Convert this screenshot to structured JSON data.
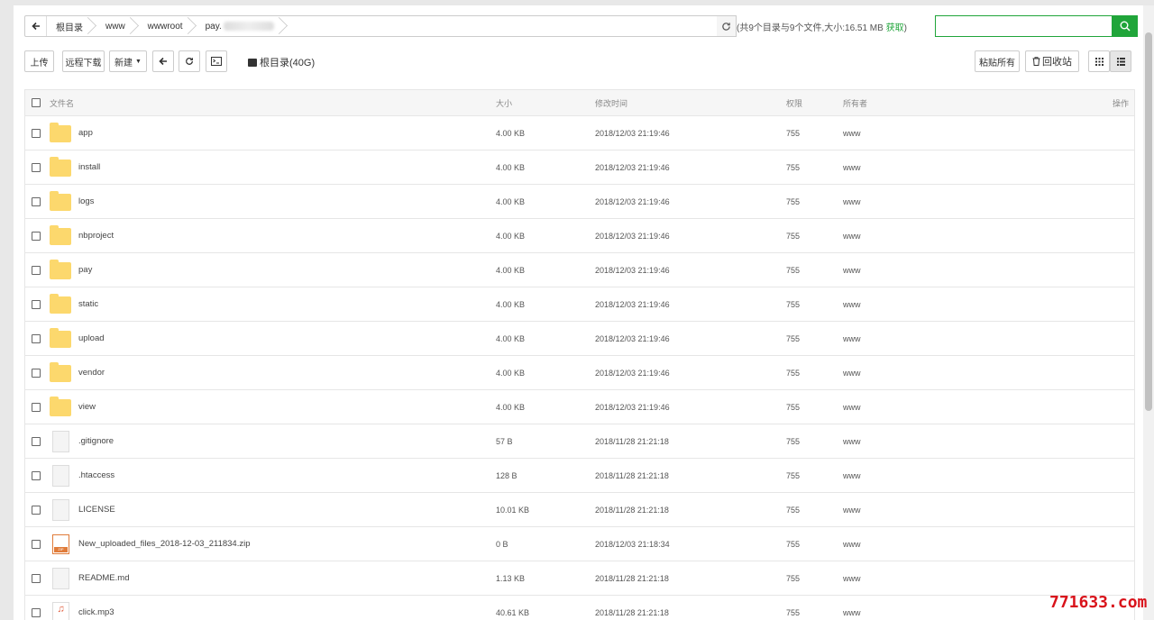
{
  "pathbar": {
    "back_icon": "arrow-left-icon",
    "crumbs": [
      "根目录",
      "www",
      "wwwroot",
      "pay."
    ],
    "summary": "(共9个目录与9个文件,大小:16.51 MB",
    "fetch_label": "获取",
    "summary_close": ")",
    "search_value": "",
    "search_icon": "search-icon",
    "accent": "#20a53a"
  },
  "toolbar": {
    "upload": "上传",
    "remote_download": "远程下载",
    "new": "新建",
    "disk_label": "根目录(40G)",
    "paste_all": "粘贴所有",
    "recycle_bin": "回收站"
  },
  "table": {
    "headers": {
      "name": "文件名",
      "size": "大小",
      "mtime": "修改时间",
      "perm": "权限",
      "owner": "所有者",
      "ops": "操作"
    },
    "rows": [
      {
        "type": "folder",
        "name": "app",
        "size": "4.00 KB",
        "mtime": "2018/12/03 21:19:46",
        "perm": "755",
        "owner": "www"
      },
      {
        "type": "folder",
        "name": "install",
        "size": "4.00 KB",
        "mtime": "2018/12/03 21:19:46",
        "perm": "755",
        "owner": "www"
      },
      {
        "type": "folder",
        "name": "logs",
        "size": "4.00 KB",
        "mtime": "2018/12/03 21:19:46",
        "perm": "755",
        "owner": "www"
      },
      {
        "type": "folder",
        "name": "nbproject",
        "size": "4.00 KB",
        "mtime": "2018/12/03 21:19:46",
        "perm": "755",
        "owner": "www"
      },
      {
        "type": "folder",
        "name": "pay",
        "size": "4.00 KB",
        "mtime": "2018/12/03 21:19:46",
        "perm": "755",
        "owner": "www"
      },
      {
        "type": "folder",
        "name": "static",
        "size": "4.00 KB",
        "mtime": "2018/12/03 21:19:46",
        "perm": "755",
        "owner": "www"
      },
      {
        "type": "folder",
        "name": "upload",
        "size": "4.00 KB",
        "mtime": "2018/12/03 21:19:46",
        "perm": "755",
        "owner": "www"
      },
      {
        "type": "folder",
        "name": "vendor",
        "size": "4.00 KB",
        "mtime": "2018/12/03 21:19:46",
        "perm": "755",
        "owner": "www"
      },
      {
        "type": "folder",
        "name": "view",
        "size": "4.00 KB",
        "mtime": "2018/12/03 21:19:46",
        "perm": "755",
        "owner": "www"
      },
      {
        "type": "file",
        "name": ".gitignore",
        "size": "57 B",
        "mtime": "2018/11/28 21:21:18",
        "perm": "755",
        "owner": "www"
      },
      {
        "type": "file",
        "name": ".htaccess",
        "size": "128 B",
        "mtime": "2018/11/28 21:21:18",
        "perm": "755",
        "owner": "www"
      },
      {
        "type": "file",
        "name": "LICENSE",
        "size": "10.01 KB",
        "mtime": "2018/11/28 21:21:18",
        "perm": "755",
        "owner": "www"
      },
      {
        "type": "zip",
        "name": "New_uploaded_files_2018-12-03_211834.zip",
        "size": "0 B",
        "mtime": "2018/12/03 21:18:34",
        "perm": "755",
        "owner": "www"
      },
      {
        "type": "file",
        "name": "README.md",
        "size": "1.13 KB",
        "mtime": "2018/11/28 21:21:18",
        "perm": "755",
        "owner": "www"
      },
      {
        "type": "mp3",
        "name": "click.mp3",
        "size": "40.61 KB",
        "mtime": "2018/11/28 21:21:18",
        "perm": "755",
        "owner": "www"
      }
    ]
  },
  "watermark": "771633.com"
}
